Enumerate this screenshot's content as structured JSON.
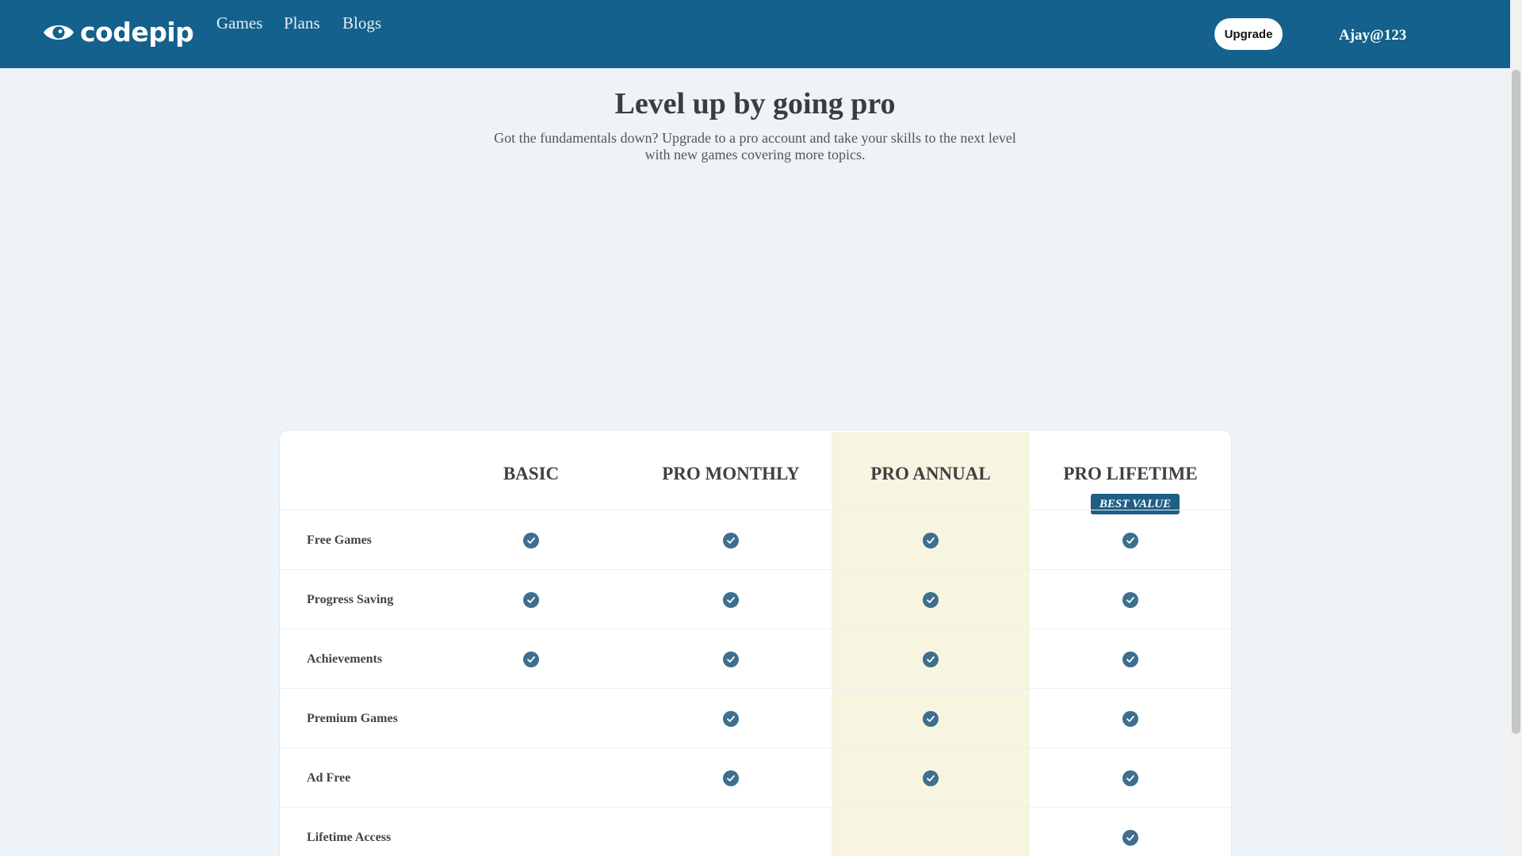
{
  "brand": {
    "name": "codepip"
  },
  "nav": {
    "links": [
      "Games",
      "Plans",
      "Blogs"
    ],
    "upgrade_label": "Upgrade",
    "username": "Ajay@123"
  },
  "hero": {
    "title": "Level up by going pro",
    "subtitle": "Got the fundamentals down? Upgrade to a pro account and take your skills to the next level with new games covering more topics."
  },
  "plans": [
    {
      "name": "BASIC"
    },
    {
      "name": "PRO MONTHLY"
    },
    {
      "name": "PRO ANNUAL"
    },
    {
      "name": "PRO LIFETIME",
      "badge": "BEST VALUE"
    }
  ],
  "features": [
    {
      "label": "Free Games",
      "included": [
        true,
        true,
        true,
        true
      ]
    },
    {
      "label": "Progress Saving",
      "included": [
        true,
        true,
        true,
        true
      ]
    },
    {
      "label": "Achievements",
      "included": [
        true,
        true,
        true,
        true
      ]
    },
    {
      "label": "Premium Games",
      "included": [
        false,
        true,
        true,
        true
      ]
    },
    {
      "label": "Ad Free",
      "included": [
        false,
        true,
        true,
        true
      ]
    },
    {
      "label": "Lifetime Access",
      "included": [
        false,
        false,
        false,
        true
      ]
    }
  ],
  "colors": {
    "header_bg": "#13618c",
    "check_icon": "#3d6f8e",
    "highlight_column": "#f7f5e0",
    "badge_bg": "#1f5f86",
    "page_bg": "#edf3f6"
  },
  "icons": {
    "logo": "eye-logo-icon",
    "check": "check-circle-icon"
  }
}
